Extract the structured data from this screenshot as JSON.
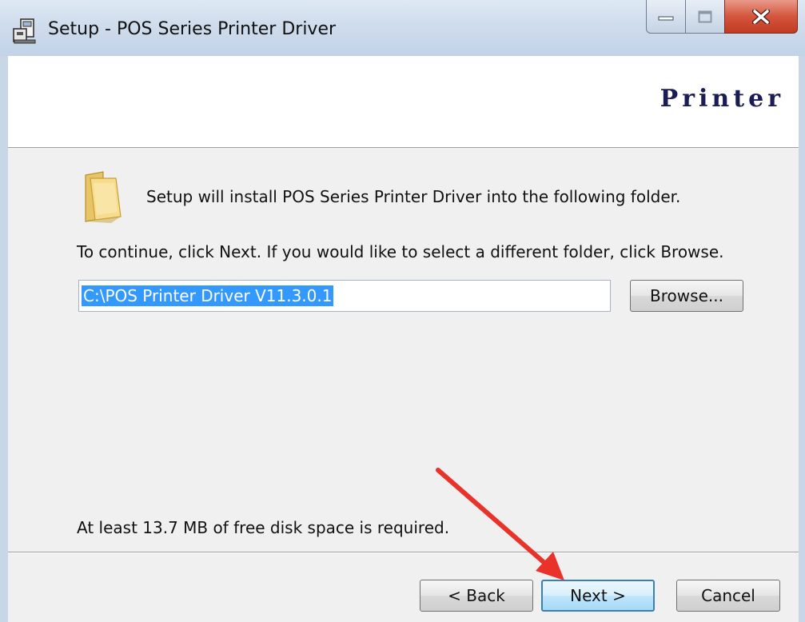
{
  "window": {
    "title": "Setup - POS Series Printer Driver",
    "icons": {
      "app": "setup-installer-icon",
      "minimize": "minimize-icon",
      "maximize": "maximize-icon",
      "close": "close-icon"
    }
  },
  "header": {
    "brand_text": "Printer"
  },
  "content": {
    "folder_icon": "folder-icon",
    "intro_text": "Setup will install POS Series Printer Driver into the following folder.",
    "instruction_text": "To continue, click Next. If you would like to select a different folder, click Browse.",
    "install_path_value": "C:\\POS Printer Driver V11.3.0.1",
    "browse_button_label": "Browse...",
    "disk_space_text": "At least 13.7 MB of free disk space is required."
  },
  "footer": {
    "back_label": "< Back",
    "next_label": "Next >",
    "cancel_label": "Cancel"
  },
  "annotation": {
    "arrow_icon": "red-arrow-icon",
    "arrow_color": "#e8322a"
  },
  "colors": {
    "selection": "#3399ff",
    "next_border": "#3c7fb1",
    "brand": "#1b1b55"
  }
}
